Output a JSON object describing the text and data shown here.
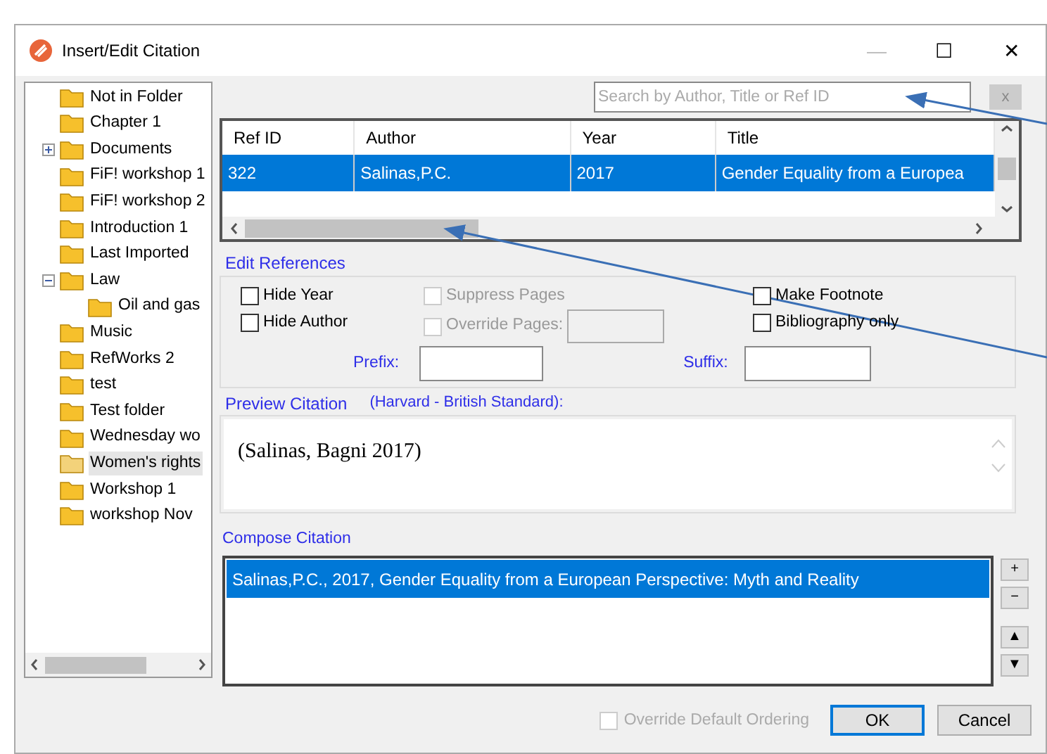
{
  "window": {
    "title": "Insert/Edit Citation",
    "controls": [
      "—",
      "☐",
      "✕"
    ]
  },
  "folders": [
    {
      "label": "Not in Folder",
      "selected": false
    },
    {
      "label": "Chapter 1",
      "selected": false
    },
    {
      "label": "Documents",
      "selected": false,
      "expanded": false
    },
    {
      "label": "FiF! workshop 1",
      "selected": false
    },
    {
      "label": "FiF! workshop 2",
      "selected": false
    },
    {
      "label": "Introduction 1",
      "selected": false
    },
    {
      "label": "Last Imported",
      "selected": false
    },
    {
      "label": "Law",
      "selected": false,
      "expanded": true,
      "children": [
        {
          "label": "Oil and gas",
          "selected": false
        }
      ]
    },
    {
      "label": "Music",
      "selected": false
    },
    {
      "label": "RefWorks 2",
      "selected": false
    },
    {
      "label": "test",
      "selected": false
    },
    {
      "label": "Test folder",
      "selected": false
    },
    {
      "label": "Wednesday wo",
      "selected": false
    },
    {
      "label": "Women's rights",
      "selected": true
    },
    {
      "label": "Workshop 1",
      "selected": false
    },
    {
      "label": "workshop Nov",
      "selected": false
    }
  ],
  "search": {
    "placeholder": "Search by Author, Title or Ref ID",
    "clear": "x"
  },
  "table": {
    "columns": [
      "Ref ID",
      "Author",
      "Year",
      "Title"
    ],
    "rows": [
      {
        "cells": [
          "322",
          "Salinas,P.C.",
          "2017",
          "Gender Equality from a Europea"
        ],
        "selected": true
      }
    ]
  },
  "edit_references": {
    "title": "Edit References",
    "options": [
      {
        "label": "Hide Year",
        "checked": false,
        "disabled": false
      },
      {
        "label": "Hide Author",
        "checked": false,
        "disabled": false
      },
      {
        "label": "Suppress Pages",
        "checked": false,
        "disabled": true
      },
      {
        "label": "Override Pages:",
        "checked": false,
        "disabled": true
      },
      {
        "label": "Make Footnote",
        "checked": false,
        "disabled": false
      },
      {
        "label": "Bibliography only",
        "checked": false,
        "disabled": false
      }
    ],
    "prefix": "Prefix:",
    "suffix": "Suffix:"
  },
  "preview": {
    "title": "Preview Citation",
    "style": "(Harvard - British Standard):",
    "text": "(Salinas, Bagni 2017)"
  },
  "compose": {
    "title": "Compose Citation",
    "items": [
      {
        "text": "Salinas,P.C., 2017, Gender Equality from a European Perspective: Myth and Reality",
        "selected": true
      }
    ],
    "tools": [
      "+",
      "−",
      "▲",
      "▼"
    ]
  },
  "override_ordering": {
    "label": "Override Default Ordering",
    "checked": false,
    "disabled": true
  },
  "buttons": [
    "OK",
    "Cancel"
  ]
}
